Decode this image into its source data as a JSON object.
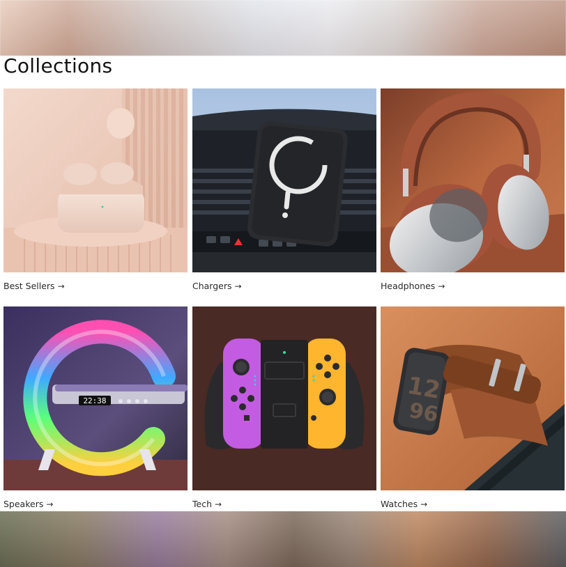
{
  "section": {
    "title": "Collections"
  },
  "collections": [
    {
      "label": "Best Sellers",
      "arrow": "→",
      "image": "earbuds-case"
    },
    {
      "label": "Chargers",
      "arrow": "→",
      "image": "car-mount-charger"
    },
    {
      "label": "Headphones",
      "arrow": "→",
      "image": "over-ear-headphones"
    },
    {
      "label": "Speakers",
      "arrow": "→",
      "image": "rgb-lamp-speaker"
    },
    {
      "label": "Tech",
      "arrow": "→",
      "image": "game-controller-grip"
    },
    {
      "label": "Watches",
      "arrow": "→",
      "image": "smartwatch-leather-band"
    }
  ],
  "display": {
    "clock": "22:38"
  },
  "colors": {
    "accent_pink": "#e8c4b1",
    "headphone_brown": "#a5553a",
    "joycon_purple": "#c45be3",
    "joycon_orange": "#ffb52e",
    "controller_bg": "#4a2a25",
    "watch_bg": "#c47a4c"
  }
}
